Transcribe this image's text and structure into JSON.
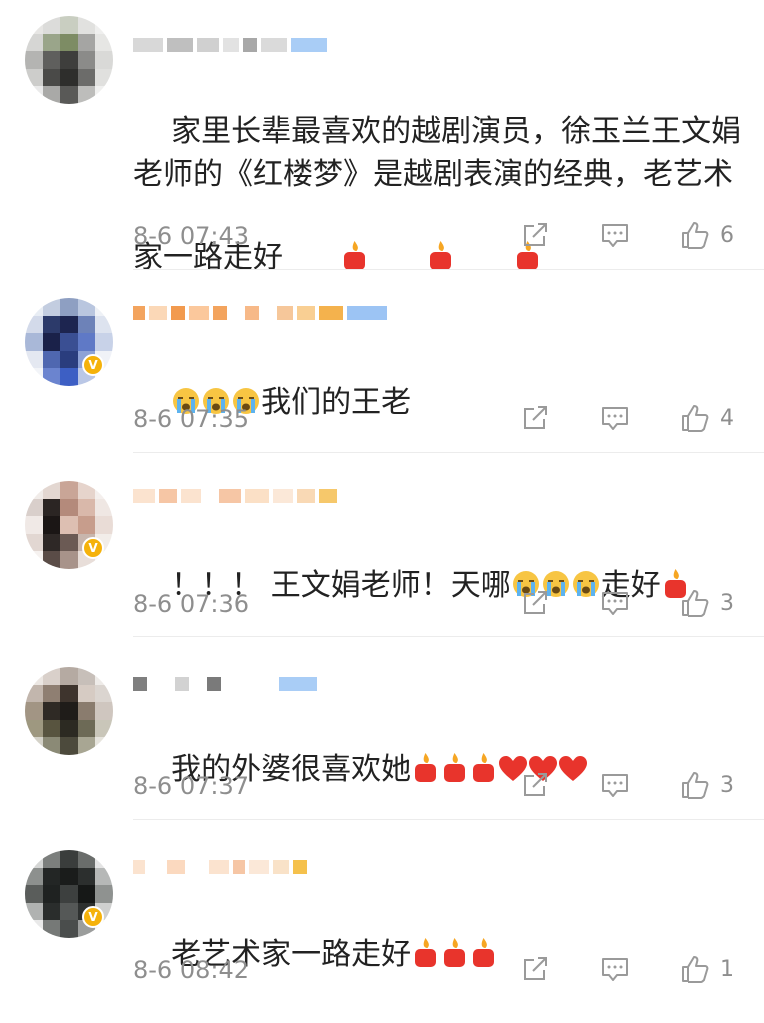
{
  "comments": [
    {
      "text": "家里长辈最喜欢的越剧演员，徐玉兰王文娟老师的《红楼梦》是越剧表演的经典，老艺术家一路走好",
      "emojis": [
        "candle-icon",
        "candle-icon",
        "candle-icon"
      ],
      "time": "8-6 07:43",
      "likes": "6",
      "verified": false
    },
    {
      "text": "我们的王老",
      "emojis_before": [
        "crying-face-icon",
        "crying-face-icon",
        "crying-face-icon"
      ],
      "time": "8-6 07:35",
      "likes": "4",
      "verified": true
    },
    {
      "text_part1": "！！！ 王文娟老师！天哪",
      "text_part2": "走好",
      "emojis_mid": [
        "crying-face-icon",
        "crying-face-icon",
        "crying-face-icon"
      ],
      "emojis": [
        "candle-icon"
      ],
      "time": "8-6 07:36",
      "likes": "3",
      "verified": true
    },
    {
      "text": "我的外婆很喜欢她",
      "emojis": [
        "candle-icon",
        "candle-icon",
        "candle-icon",
        "heart-icon",
        "heart-icon",
        "heart-icon"
      ],
      "time": "8-6 07:37",
      "likes": "3",
      "verified": false
    },
    {
      "text": "老艺术家一路走好",
      "emojis": [
        "candle-icon",
        "candle-icon",
        "candle-icon"
      ],
      "time": "8-6 08:42",
      "likes": "1",
      "verified": true
    }
  ],
  "colors": {
    "text": "#222222",
    "meta": "#8e8e8e",
    "icon": "#9a9a9a",
    "divider": "#ececec",
    "verified_badge": "#f5b20b",
    "candle": "#e8342c",
    "flame": "#f6a623",
    "heart": "#e8342c"
  }
}
